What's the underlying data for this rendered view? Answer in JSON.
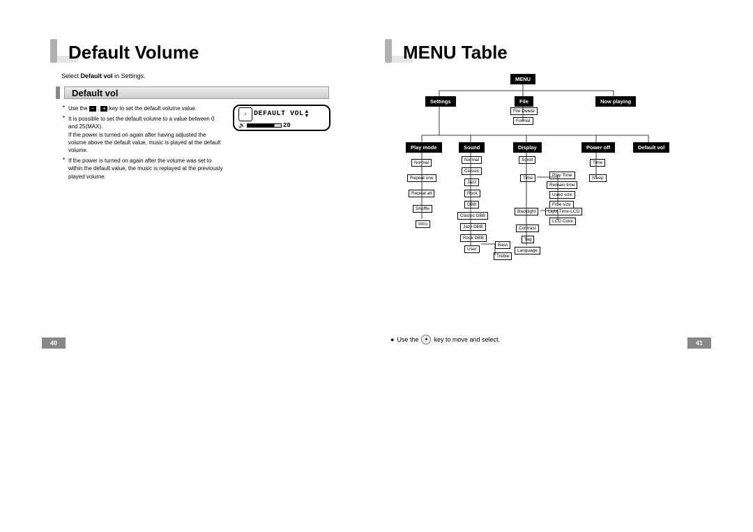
{
  "left": {
    "title": "Default Volume",
    "intro_pre": "Select ",
    "intro_bold": "Default vol",
    "intro_post": " in Settings.",
    "section": "Default vol",
    "bullet1_pre": "Use the ",
    "bullet1_post": " key to set the default volume value.",
    "bullet2": "It is possible to set the default volume to a value between 0 and 25(MAX).",
    "bullet2_sub": "If the power is turned on again after having adjusted the volume above the default value, music is played at the default volume.",
    "bullet3": "If the power is turned on again after the volume was set to within the default value, the music is replayed at the previously played volume.",
    "lcd_label": "DEFAULT VOL",
    "lcd_value": "20",
    "page_num": "40",
    "minus": "−",
    "plus": "+"
  },
  "right": {
    "title": "MENU Table",
    "footer_pre": "Use the ",
    "footer_post": " key to move and select.",
    "page_num": "41",
    "menu": {
      "root": "MENU",
      "top": {
        "settings": "Settings",
        "file": "File",
        "nowplaying": "Now playing"
      },
      "file_children": {
        "filedelete": "File Delete",
        "format": "Format"
      },
      "settings_children": {
        "playmode": "Play mode",
        "sound": "Sound",
        "display": "Display",
        "poweroff": "Power off",
        "defaultvol": "Default vol"
      },
      "playmode_items": {
        "normal": "Normal",
        "repeatone": "Repeat one",
        "repeatall": "Repeat all",
        "shuffle": "Shuffle",
        "intro": "Intro"
      },
      "sound_items": {
        "normal": "Normal",
        "classic": "Classic",
        "jazz": "Jazz",
        "rock": "Rock",
        "dbb": "DBB",
        "classicdbb": "Classic DBB",
        "jazzdbb": "Jazz DBB",
        "rockdbb": "Rock DBB",
        "user": "User"
      },
      "sound_user_sub": {
        "bass": "Bass",
        "treble": "Treble"
      },
      "display_items": {
        "scroll": "Scroll",
        "time": "Time",
        "backlight": "Backlight",
        "contrast": "Contrast",
        "tag": "Tag",
        "language": "Language"
      },
      "display_time_sub": {
        "playtime": "Play Time",
        "remaintime": "Remain time",
        "usedsize": "Used size",
        "freesize": "Free size"
      },
      "display_backlight_sub": {
        "lighttime": "Light Time-LCD",
        "lcdcolor": "LCD Color"
      },
      "poweroff_items": {
        "time": "Time",
        "sleep": "Sleep"
      }
    }
  }
}
